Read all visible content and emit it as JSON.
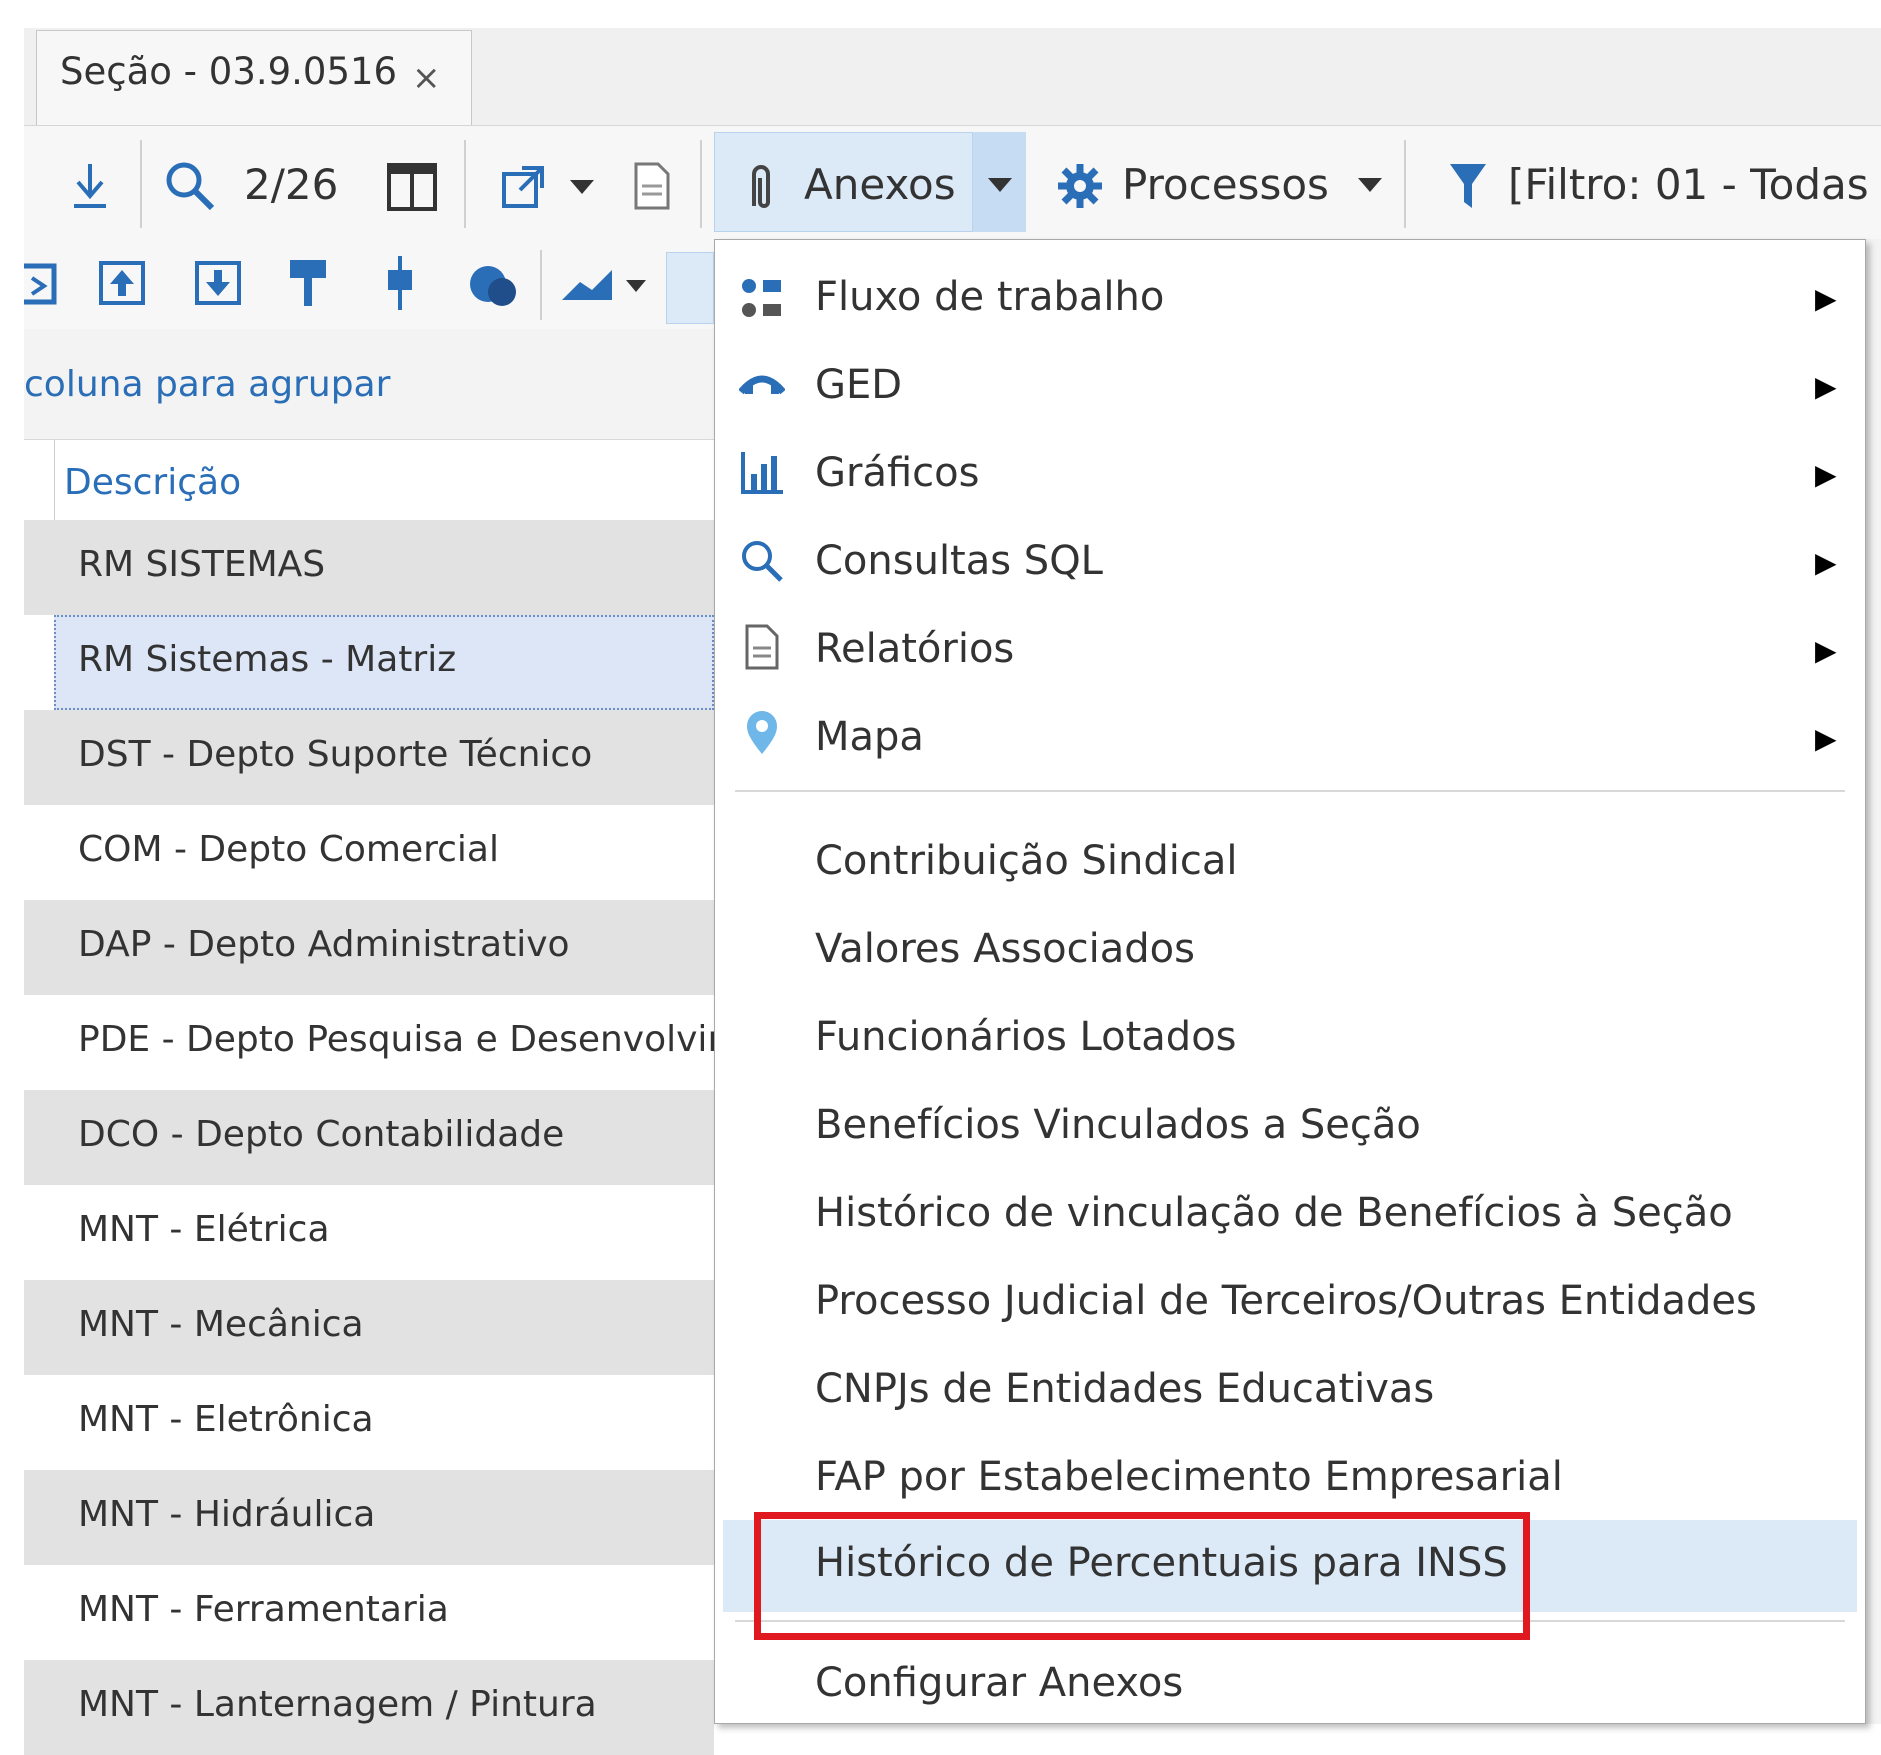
{
  "tab": {
    "label": "Seção - 03.9.0516",
    "close": "×"
  },
  "toolbar": {
    "page_counter": "2/26",
    "anexos_label": "Anexos",
    "processos_label": "Processos",
    "filter_label": "[Filtro: 01 - Todas"
  },
  "group_bar": {
    "hint": "coluna para agrupar"
  },
  "grid": {
    "column_header": "Descrição",
    "rows": [
      "RM SISTEMAS",
      "RM Sistemas - Matriz",
      "DST - Depto Suporte Técnico",
      "COM - Depto Comercial",
      "DAP - Depto Administrativo",
      "PDE - Depto Pesquisa e Desenvolvimento",
      "DCO - Depto Contabilidade",
      "MNT - Elétrica",
      "MNT - Mecânica",
      "MNT - Eletrônica",
      "MNT - Hidráulica",
      "MNT - Ferramentaria",
      "MNT - Lanternagem / Pintura"
    ]
  },
  "menu": {
    "submenus": [
      {
        "label": "Fluxo de trabalho",
        "icon": "workflow-icon"
      },
      {
        "label": "GED",
        "icon": "ged-icon"
      },
      {
        "label": "Gráficos",
        "icon": "chart-icon"
      },
      {
        "label": "Consultas SQL",
        "icon": "search-icon"
      },
      {
        "label": "Relatórios",
        "icon": "report-icon"
      },
      {
        "label": "Mapa",
        "icon": "map-pin-icon"
      }
    ],
    "items": [
      "Contribuição Sindical",
      "Valores Associados",
      "Funcionários Lotados",
      "Benefícios Vinculados a Seção",
      "Histórico de vinculação de Benefícios à Seção",
      "Processo Judicial de Terceiros/Outras Entidades",
      "CNPJs de Entidades Educativas",
      "FAP por Estabelecimento Empresarial",
      "Histórico de Percentuais para INSS"
    ],
    "footer_item": "Configurar Anexos"
  },
  "colors": {
    "accent": "#2a6eb7",
    "highlight": "#dce9f7",
    "annotation": "#e0181f"
  }
}
